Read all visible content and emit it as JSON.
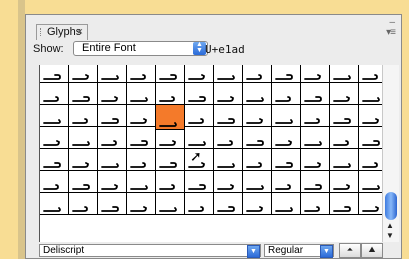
{
  "panel": {
    "tab_title": "Glyphs",
    "tab_close": "×",
    "collapse_glyph": "–",
    "menu_glyph": "▾≡"
  },
  "toolbar": {
    "show_label": "Show:",
    "show_value": "Entire Font",
    "unicode": "U+e1ad"
  },
  "grid": {
    "rows": 7,
    "cols": 11,
    "selected_row": 2,
    "selected_col": 4,
    "selected_color": "#f47a2a"
  },
  "scrollbar": {
    "up_arrow": "▲",
    "down_arrow": "▼"
  },
  "status": {
    "font_family": "Deliscript",
    "font_style": "Regular"
  },
  "colors": {
    "background": "#f8dd94",
    "accent": "#2a6ad8"
  }
}
